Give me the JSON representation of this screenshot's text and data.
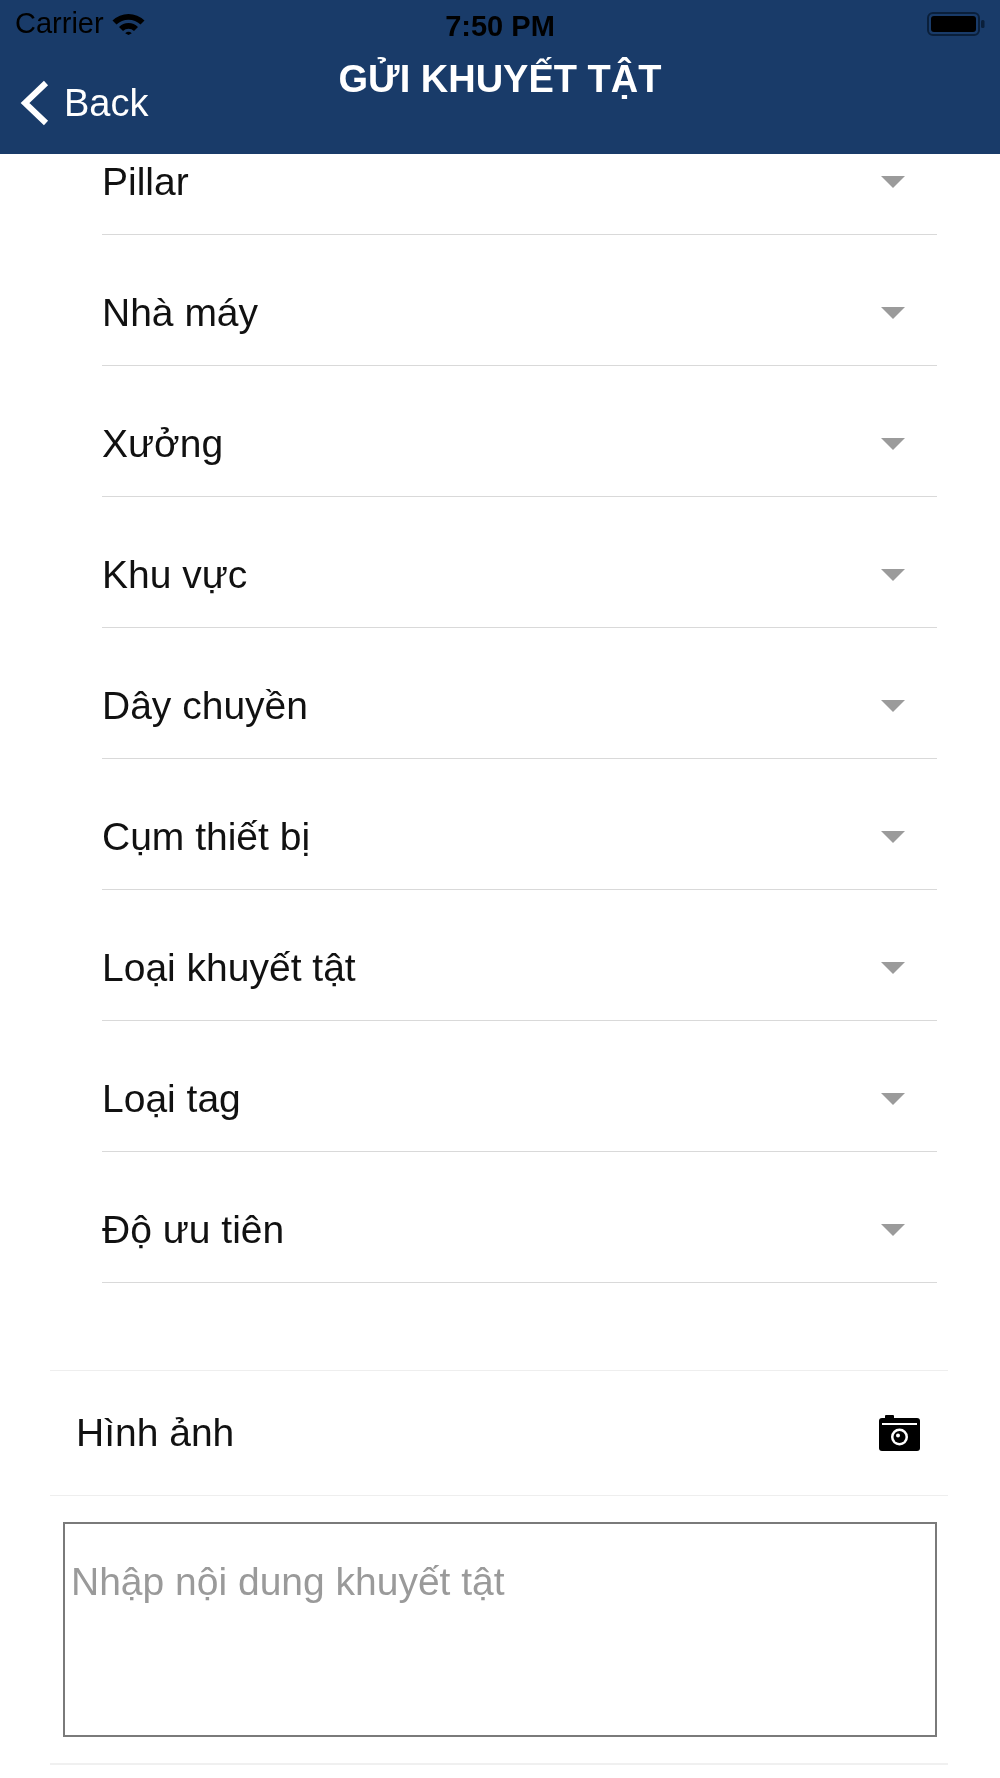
{
  "status_bar": {
    "carrier": "Carrier",
    "time": "7:50 PM"
  },
  "nav_bar": {
    "back_label": "Back",
    "title": "GỬI KHUYẾT TẬT"
  },
  "fields": [
    {
      "label": "Pillar"
    },
    {
      "label": "Nhà máy"
    },
    {
      "label": "Xưởng"
    },
    {
      "label": "Khu vực"
    },
    {
      "label": "Dây chuyền"
    },
    {
      "label": "Cụm thiết bị"
    },
    {
      "label": "Loại khuyết tật"
    },
    {
      "label": "Loại tag"
    },
    {
      "label": "Độ ưu tiên"
    }
  ],
  "image_row": {
    "label": "Hình ảnh"
  },
  "description": {
    "placeholder": "Nhập nội dung khuyết tật"
  }
}
